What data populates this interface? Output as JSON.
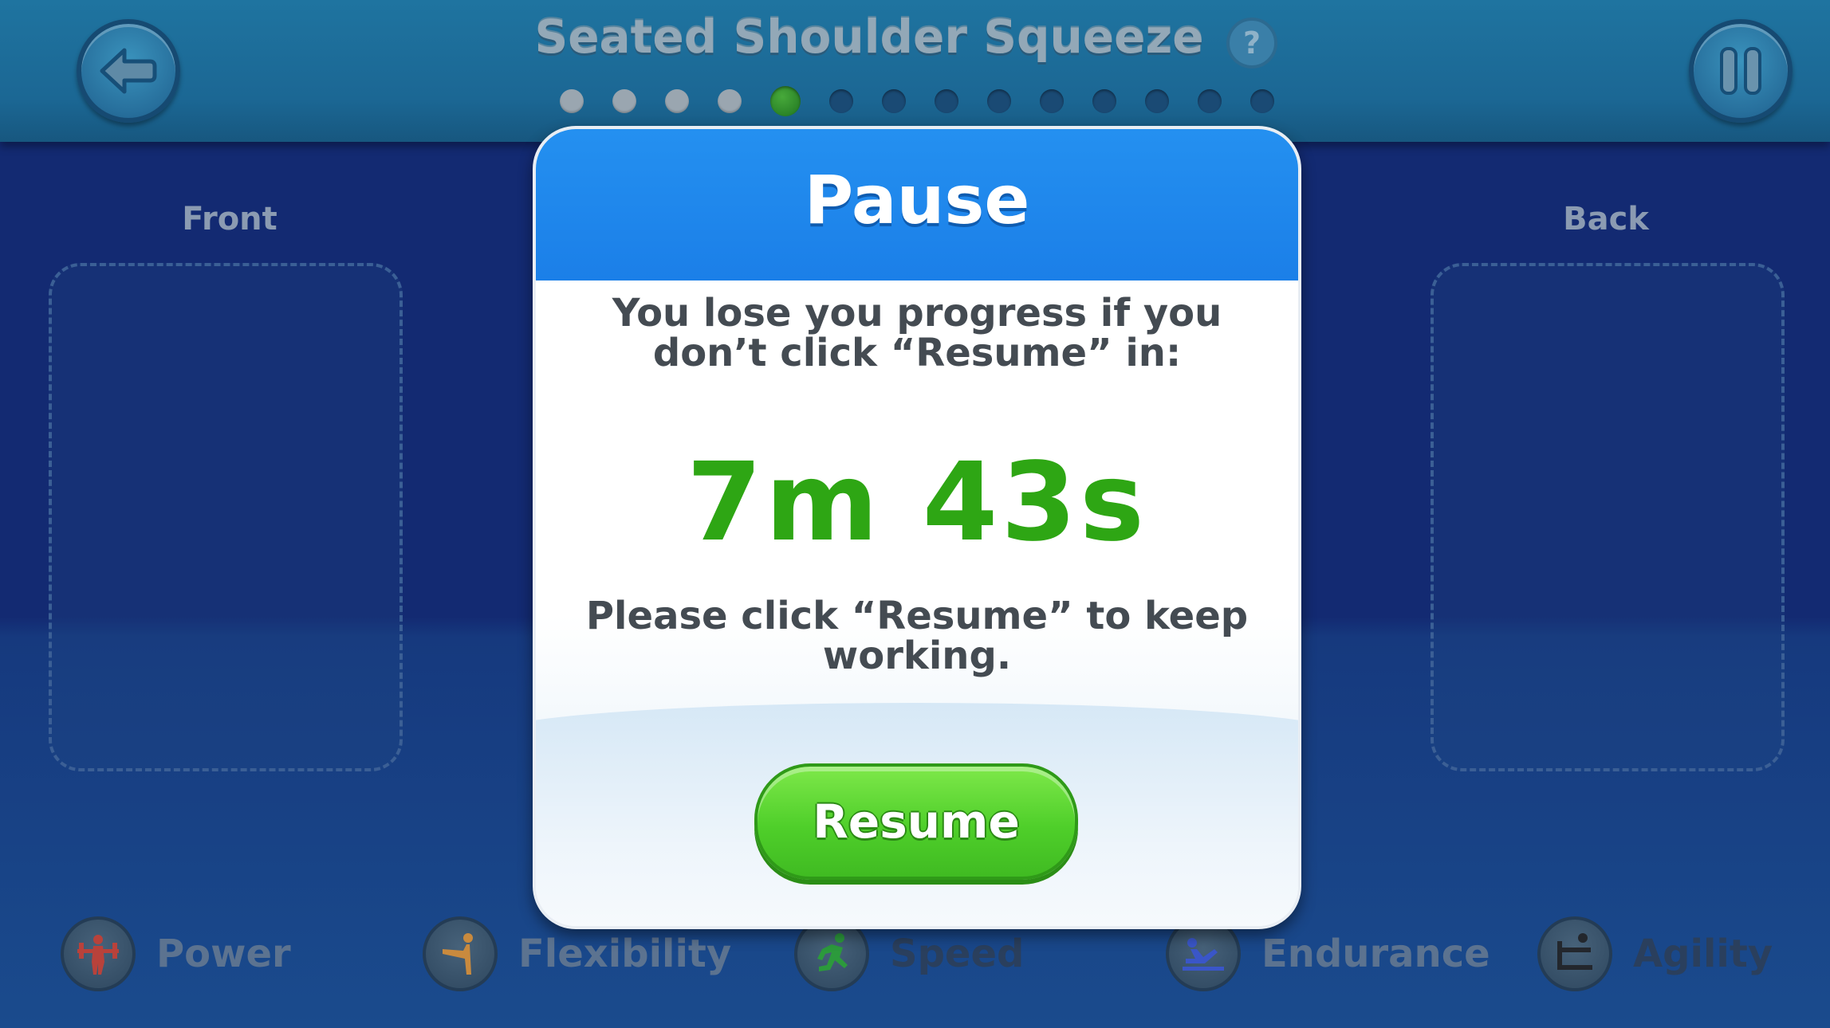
{
  "header": {
    "title": "Seated Shoulder Squeeze",
    "help_label": "?",
    "back_icon": "arrow-left-icon",
    "pause_icon": "pause-icon",
    "progress": {
      "total": 14,
      "completed": 4,
      "current_index": 5
    }
  },
  "sides": {
    "front_label": "Front",
    "back_label": "Back"
  },
  "stats": [
    {
      "label": "Power",
      "icon": "weightlifter-icon"
    },
    {
      "label": "Flexibility",
      "icon": "stretch-icon"
    },
    {
      "label": "Speed",
      "icon": "runner-icon"
    },
    {
      "label": "Endurance",
      "icon": "situp-icon"
    },
    {
      "label": "Agility",
      "icon": "hurdle-icon"
    }
  ],
  "modal": {
    "title": "Pause",
    "message1": "You lose you progress if you don’t click “Resume” in:",
    "timer": "7m 43s",
    "message2": "Please click “Resume” to keep working.",
    "resume_label": "Resume"
  },
  "colors": {
    "modal_header": "#1b7fe8",
    "timer": "#2ea614",
    "resume_button": "#4fcf2a"
  }
}
